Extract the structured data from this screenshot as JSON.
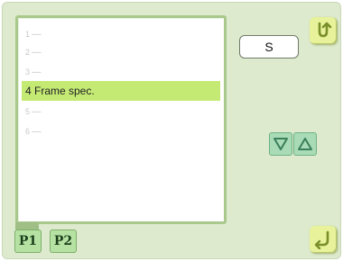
{
  "list": {
    "items": [
      {
        "number": "1",
        "label": "-----",
        "selected": false
      },
      {
        "number": "2",
        "label": "-----",
        "selected": false
      },
      {
        "number": "3",
        "label": "-----",
        "selected": false
      },
      {
        "number": "4",
        "label": "4 Frame spec.",
        "selected": true
      },
      {
        "number": "5",
        "label": "-----",
        "selected": false
      },
      {
        "number": "6",
        "label": "-----",
        "selected": false
      }
    ]
  },
  "size_value": "S",
  "pages": {
    "p1": "P1",
    "p2": "P2",
    "active": "P1"
  },
  "icons": {
    "return_top": "u-turn-return-icon",
    "return_bottom": "corner-return-icon",
    "down": "triangle-down-icon",
    "up": "triangle-up-icon"
  },
  "colors": {
    "background": "#ddeacd",
    "selected_row": "#c4ea74",
    "arrow_button": "#a8dbb6",
    "page_button": "#b5e2a3",
    "corner_button": "#e7f29a"
  }
}
